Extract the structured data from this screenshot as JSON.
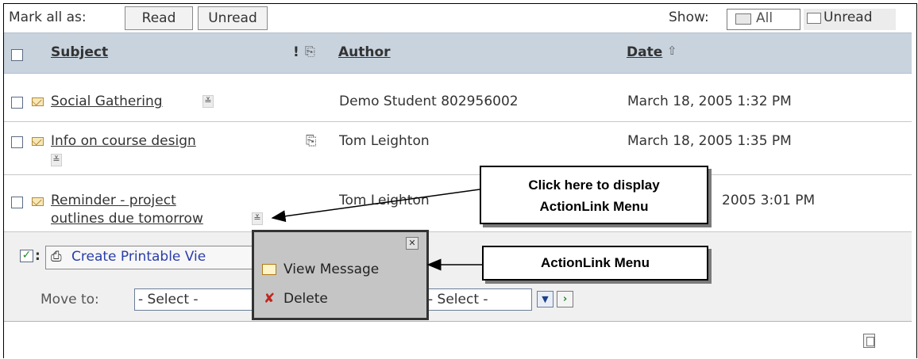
{
  "toolbar": {
    "mark_all_label": "Mark all as:",
    "read_button": "Read",
    "unread_button": "Unread",
    "show_label": "Show:",
    "show_all": "All",
    "show_unread": "Unread"
  },
  "table": {
    "headers": {
      "subject": "Subject",
      "priority": "!",
      "author": "Author",
      "date": "Date"
    },
    "rows": [
      {
        "subject": "Social Gathering",
        "author": "Demo Student 802956002",
        "date": "March 18, 2005 1:32 PM",
        "attachment": false
      },
      {
        "subject": "Info on course design",
        "author": "Tom Leighton",
        "date": "March 18, 2005 1:35 PM",
        "attachment": true
      },
      {
        "subject_line1": "Reminder - project",
        "subject_line2": "outlines due tomorrow",
        "author": "Tom Leighton",
        "date_visible": "2005 3:01 PM",
        "attachment": false
      }
    ]
  },
  "footer": {
    "printable_view": "Create Printable Vie",
    "move_to_label": "Move to:",
    "select_placeholder": "- Select -",
    "select2_placeholder": "- Select -"
  },
  "popup": {
    "close_glyph": "✕",
    "items": [
      "View Message",
      "Delete"
    ]
  },
  "callouts": {
    "display_menu": "Click here to display ActionLink Menu",
    "display_menu_line1": "Click here to display",
    "display_menu_line2": "ActionLink Menu",
    "menu_label": "ActionLink Menu"
  },
  "colors": {
    "header_bg": "#c8d3de",
    "footer_bg": "#f0f0f0",
    "popup_bg": "#c5c5c5"
  }
}
